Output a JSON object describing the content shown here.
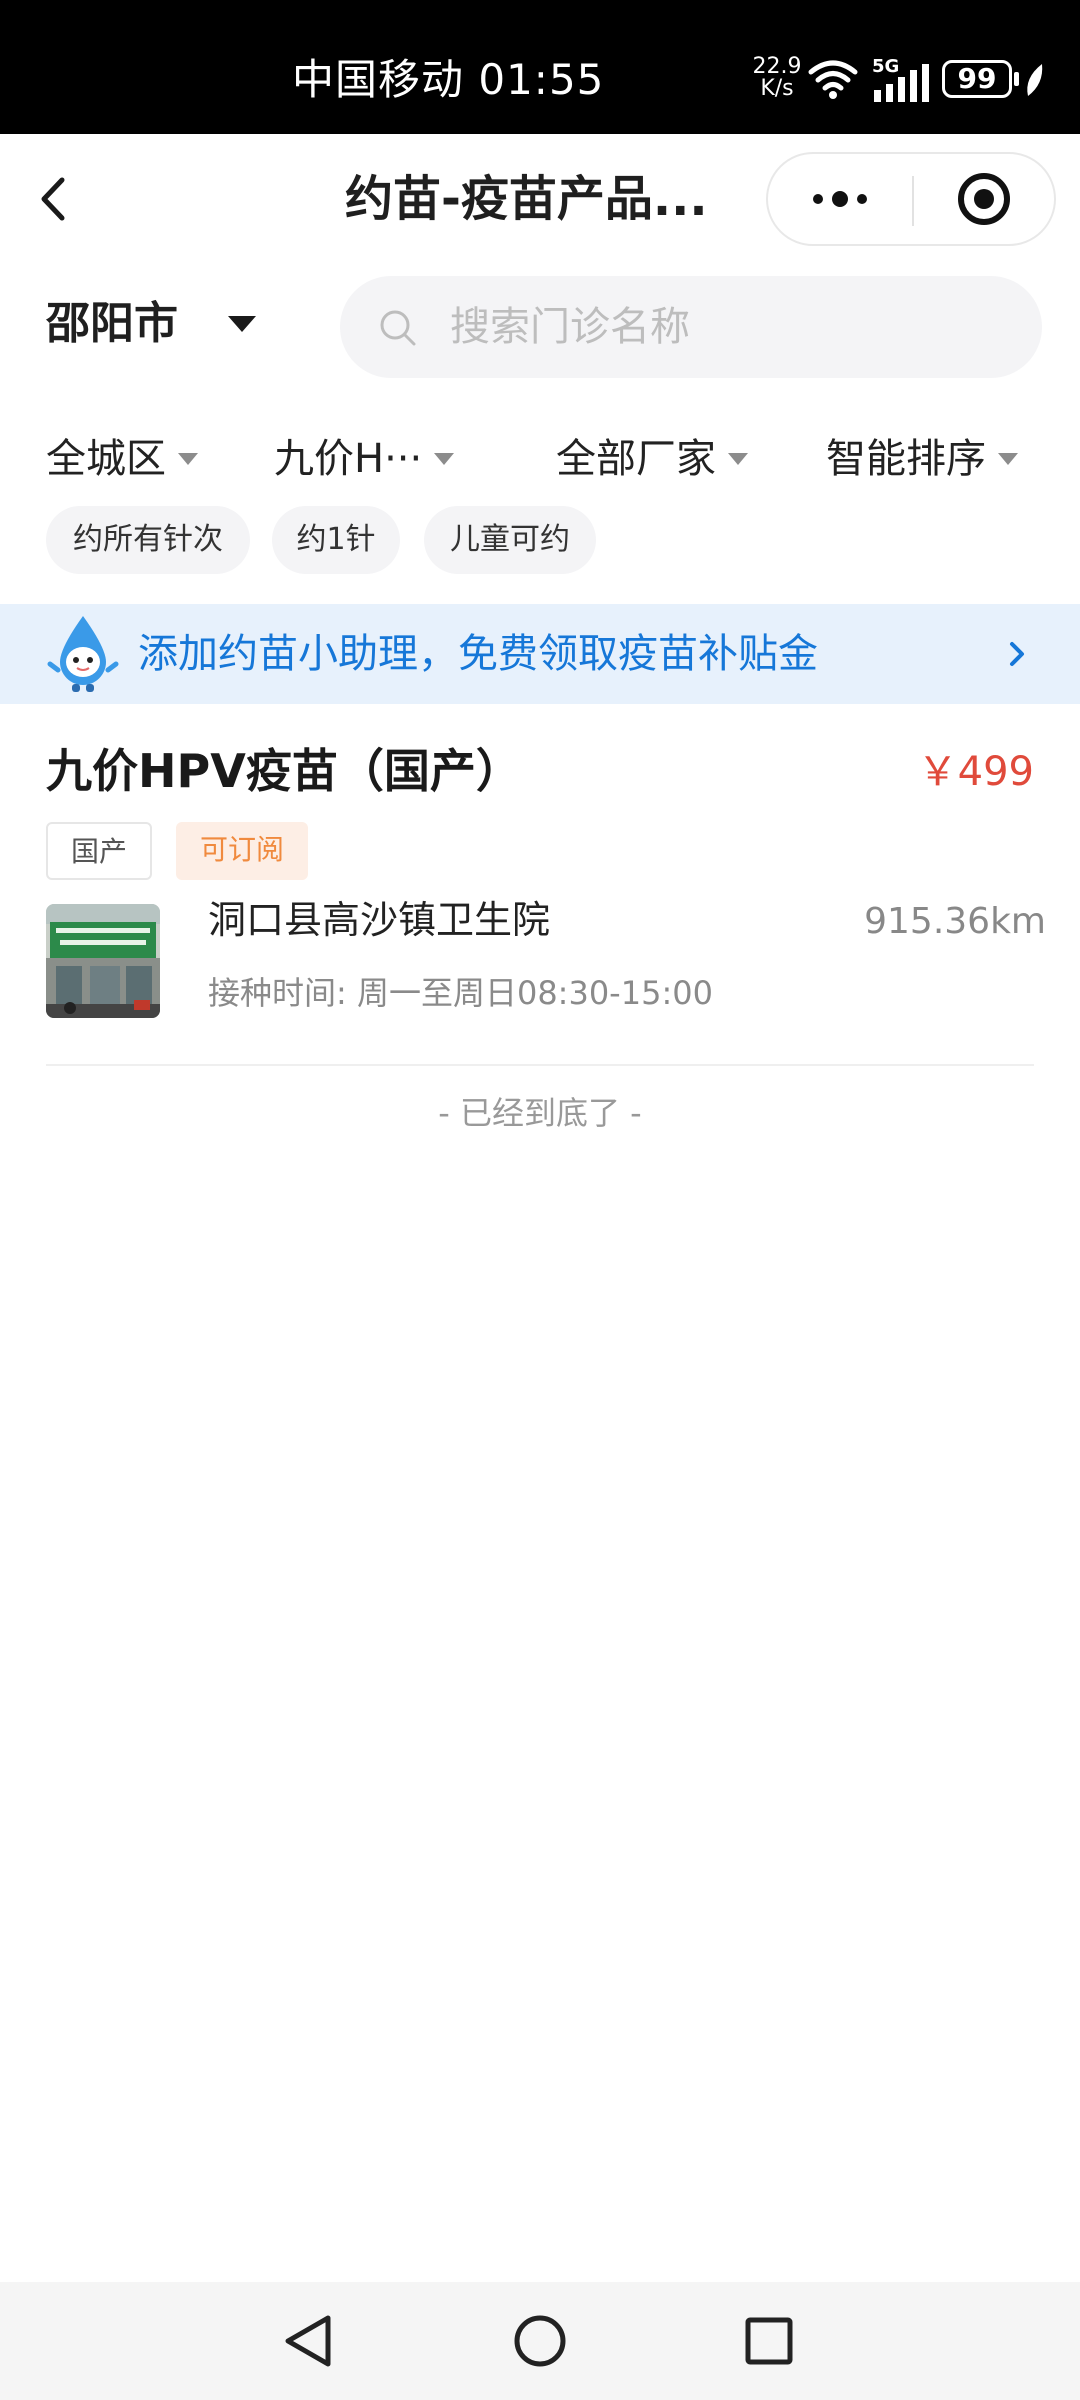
{
  "status_bar": {
    "carrier_time": "中国移动 01:55",
    "speed_value": "22.9",
    "speed_unit": "K/s",
    "network": "5G",
    "battery": "99",
    "icons": [
      "wifi-icon",
      "signal-icon",
      "battery-icon",
      "leaf-icon"
    ]
  },
  "header": {
    "title": "约苗-疫苗产品...",
    "icons": [
      "back-arrow-icon",
      "more-dots-icon",
      "target-close-icon"
    ]
  },
  "location": {
    "city": "邵阳市"
  },
  "search": {
    "placeholder": "搜索门诊名称",
    "value": ""
  },
  "filters": [
    {
      "label": "全城区"
    },
    {
      "label": "九价H···"
    },
    {
      "label": "全部厂家"
    },
    {
      "label": "智能排序"
    }
  ],
  "chips": [
    "约所有针次",
    "约1针",
    "儿童可约"
  ],
  "banner": {
    "text": "添加约苗小助理，免费领取疫苗补贴金",
    "color": "#1677d8"
  },
  "product": {
    "name": "九价HPV疫苗（国产）",
    "price": "￥499",
    "tags": [
      "国产",
      "可订阅"
    ],
    "clinic": {
      "name": "洞口县高沙镇卫生院",
      "distance": "915.36km",
      "hours": "接种时间:  周一至周日08:30-15:00"
    }
  },
  "list_end_text": "- 已经到底了 -",
  "colors": {
    "accent": "#1677d8",
    "price": "#e04a3b",
    "subscribe_tag": "#f08a3e"
  }
}
